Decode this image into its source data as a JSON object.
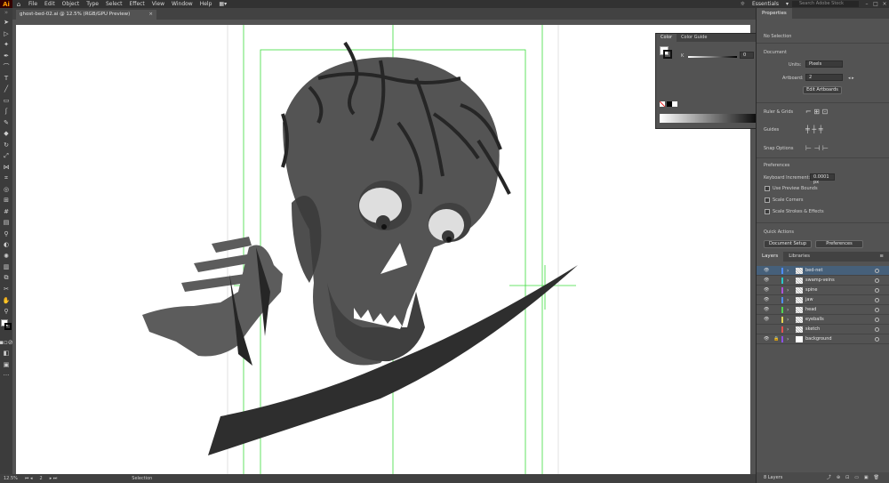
{
  "menubar": {
    "logo": "Ai",
    "home_icon": "home-icon",
    "items": [
      "File",
      "Edit",
      "Object",
      "Type",
      "Select",
      "Effect",
      "View",
      "Window",
      "Help"
    ],
    "workspace": "Essentials",
    "search_placeholder": "Search Adobe Stock"
  },
  "document": {
    "tab_title": "ghost-bed-02.ai @ 12.5% (RGB/GPU Preview)",
    "close": "×"
  },
  "statusbar": {
    "zoom": "12.5%",
    "artboard_num": "2",
    "tool_name": "Selection"
  },
  "color_panel": {
    "tabs": [
      "Color",
      "Color Guide"
    ],
    "channel_label": "K",
    "channel_value": "0",
    "unit": "%"
  },
  "properties": {
    "tab": "Properties",
    "no_selection": "No Selection",
    "section_document": "Document",
    "units_label": "Units:",
    "units_value": "Pixels",
    "artboard_label": "Artboard:",
    "artboard_value": "2",
    "edit_artboards": "Edit Artboards",
    "ruler_grid": "Ruler & Grids",
    "guides": "Guides",
    "snap_options": "Snap Options",
    "preferences": "Preferences",
    "keyboard_increment_label": "Keyboard Increment:",
    "keyboard_increment_value": "0.0001 px",
    "use_preview_bounds": "Use Preview Bounds",
    "scale_corners": "Scale Corners",
    "scale_strokes": "Scale Strokes & Effects",
    "quick_actions": "Quick Actions",
    "document_setup": "Document Setup",
    "preferences_btn": "Preferences"
  },
  "layers_panel": {
    "tabs": [
      "Layers",
      "Libraries"
    ],
    "layers": [
      {
        "name": "bed-net",
        "color": "#4f8cff",
        "visible": true,
        "locked": false
      },
      {
        "name": "swamp-veins",
        "color": "#29c8c8",
        "visible": true,
        "locked": false
      },
      {
        "name": "spine",
        "color": "#b04fd8",
        "visible": true,
        "locked": false
      },
      {
        "name": "jaw",
        "color": "#4f8cff",
        "visible": true,
        "locked": false
      },
      {
        "name": "head",
        "color": "#4fd84f",
        "visible": true,
        "locked": false
      },
      {
        "name": "eyeballs",
        "color": "#e6d84f",
        "visible": true,
        "locked": false
      },
      {
        "name": "sketch",
        "color": "#e64f4f",
        "visible": false,
        "locked": false
      },
      {
        "name": "background",
        "color": "#8a4fe6",
        "visible": true,
        "locked": true
      }
    ],
    "footer": "8 Layers"
  }
}
